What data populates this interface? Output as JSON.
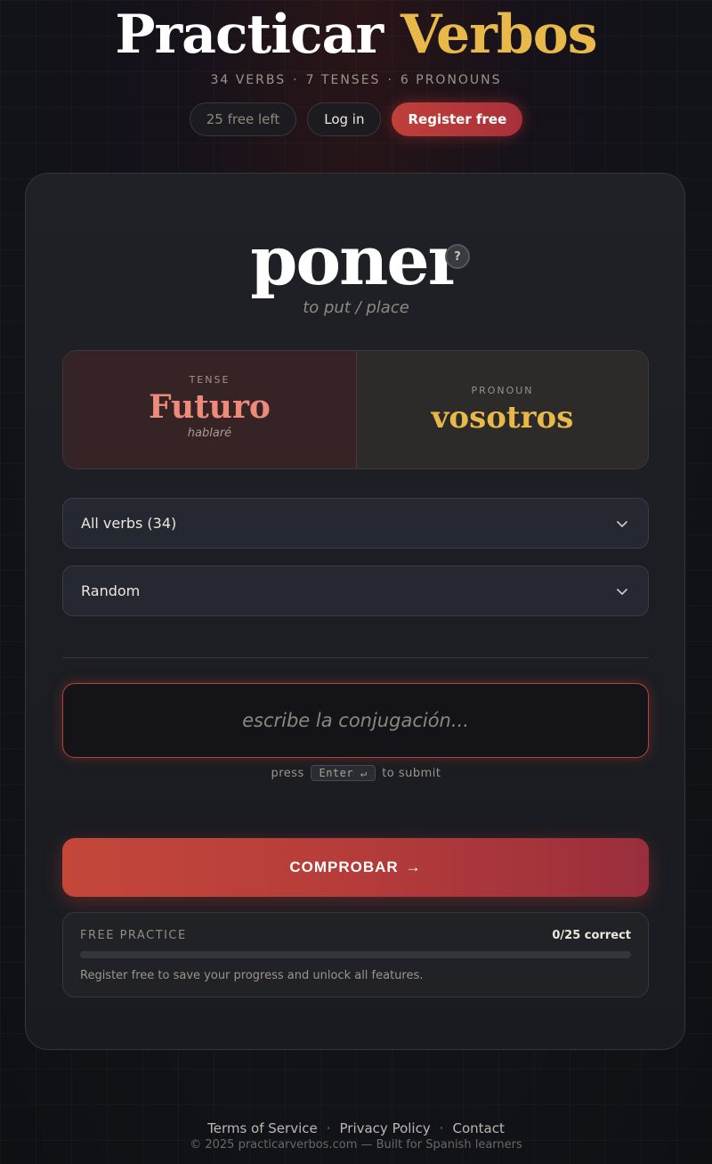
{
  "header": {
    "title_main": "Practicar",
    "title_accent": "Verbos",
    "stats": {
      "verbs": "34 VERBS",
      "tenses": "7 TENSES",
      "pronouns": "6 PRONOUNS",
      "sep": "·"
    },
    "free_left": "25 free left",
    "login_label": "Log in",
    "register_label": "Register free"
  },
  "prompt": {
    "verb": "poner",
    "help_symbol": "?",
    "translation": "to put / place",
    "tense_label": "TENSE",
    "tense": "Futuro",
    "tense_example": "hablaré",
    "pronoun_label": "PRONOUN",
    "pronoun": "vosotros"
  },
  "filters": {
    "verb_set": "All verbs (34)",
    "order": "Random"
  },
  "answer": {
    "placeholder": "escribe la conjugación...",
    "hint_before": "press",
    "hint_key": "Enter ↵",
    "hint_after": "to submit"
  },
  "submit": {
    "label": "COMPROBAR",
    "arrow": "→"
  },
  "progress": {
    "label": "FREE PRACTICE",
    "count": "0/25 correct",
    "correct": 0,
    "total": 25,
    "message": "Register free to save your progress and unlock all features."
  },
  "footer": {
    "terms": "Terms of Service",
    "privacy": "Privacy Policy",
    "contact": "Contact",
    "sep": "·",
    "copyright": "© 2025 practicarverbos.com — Built for Spanish learners"
  },
  "colors": {
    "accent_gold": "#e8b84a",
    "accent_red": "#c4473a",
    "tense_color": "#ee8a7a"
  }
}
